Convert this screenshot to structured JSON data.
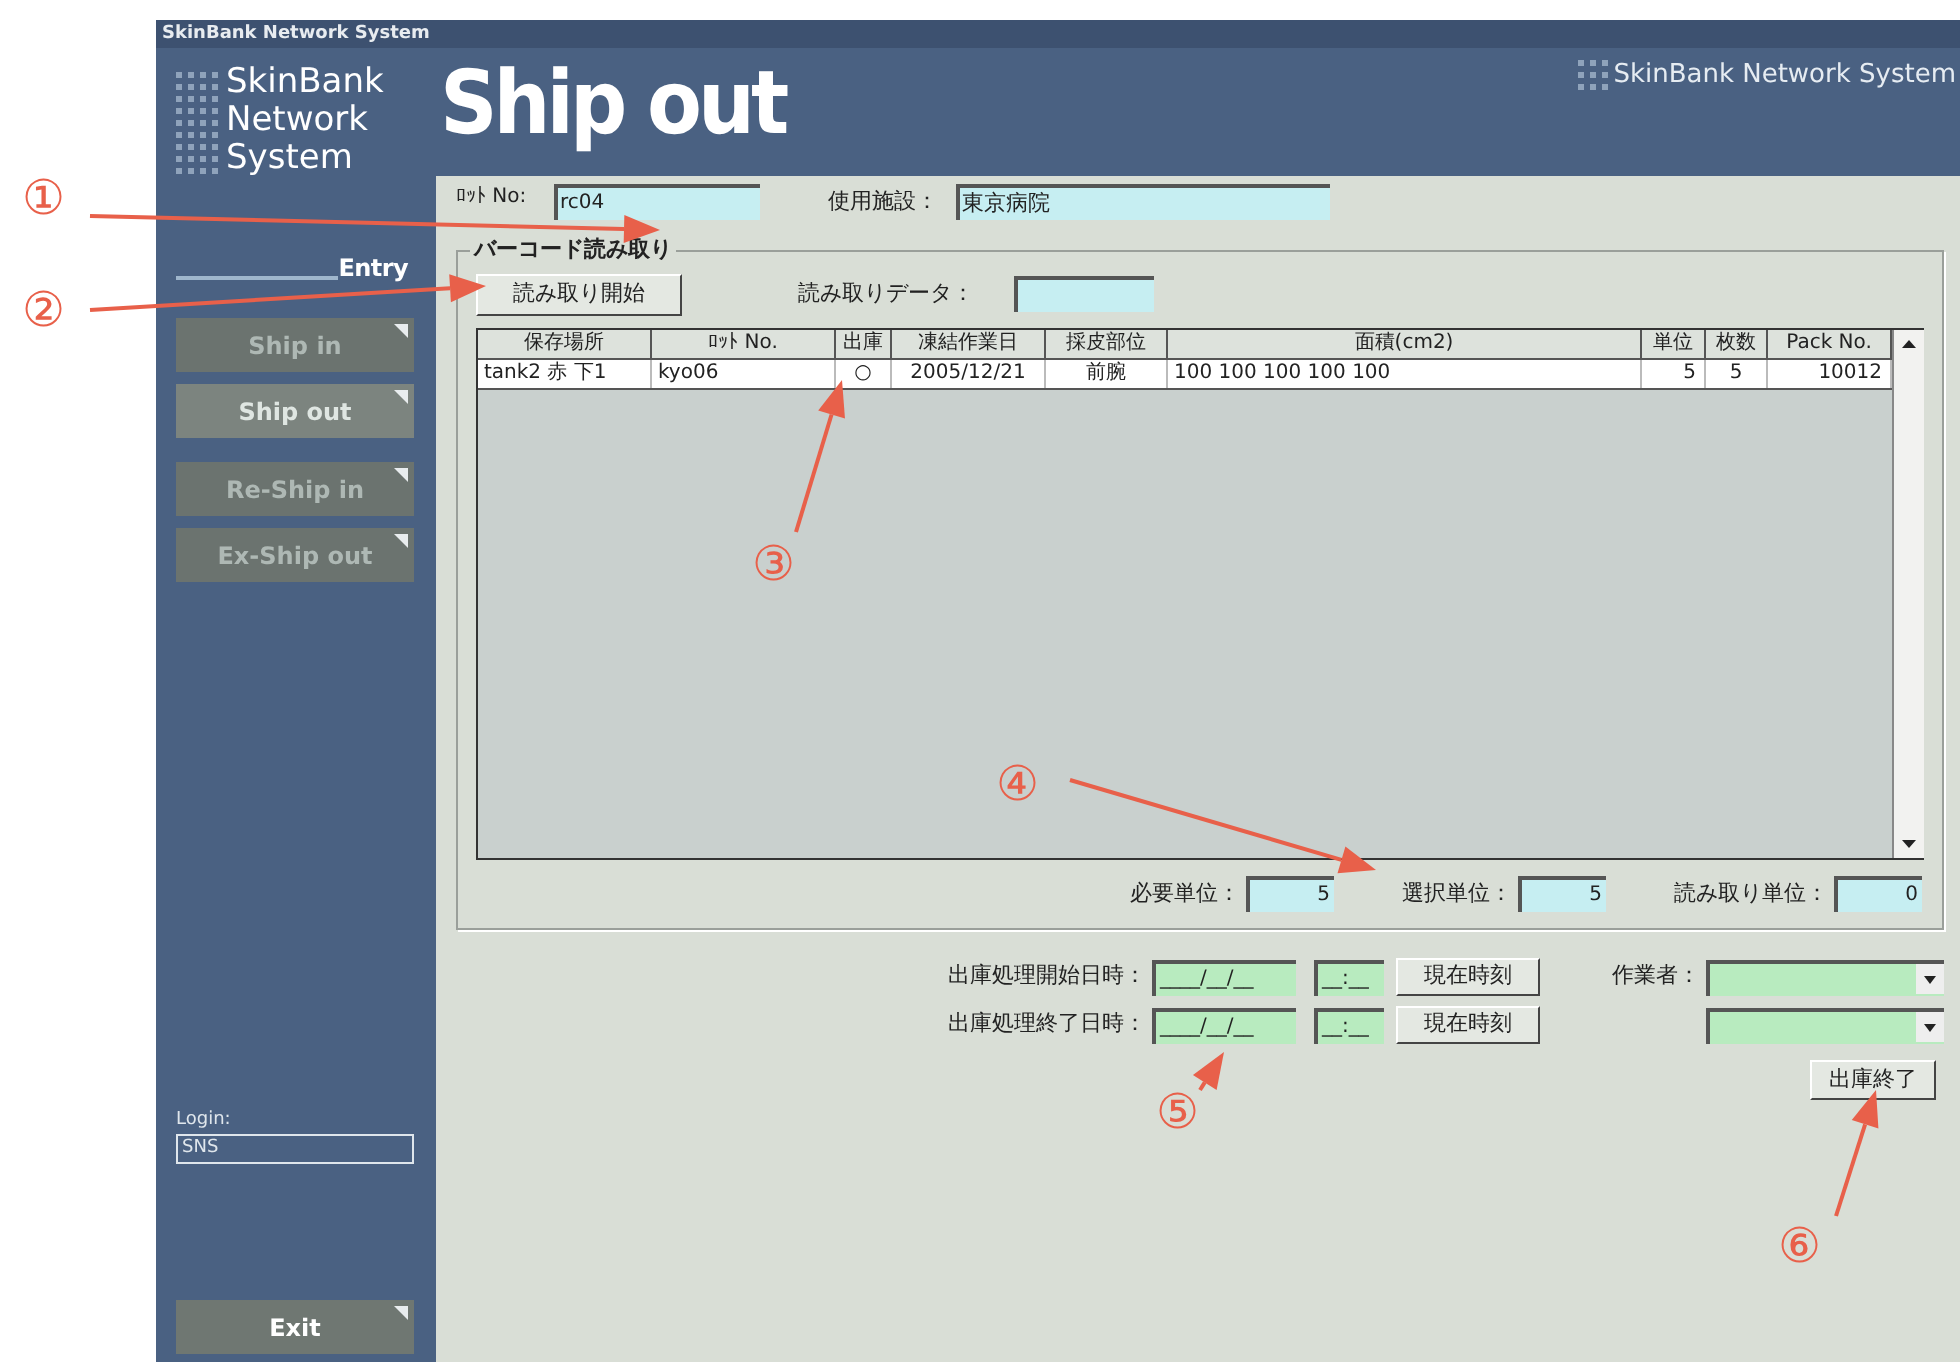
{
  "window": {
    "title": "SkinBank Network System"
  },
  "sidebar": {
    "logo_lines": [
      "SkinBank",
      "Network",
      "System"
    ],
    "section_label": "Entry",
    "nav": [
      {
        "label": "Ship in",
        "selected": false
      },
      {
        "label": "Ship out",
        "selected": true
      },
      {
        "label": "Re-Ship in",
        "selected": false
      },
      {
        "label": "Ex-Ship out",
        "selected": false
      }
    ],
    "login": {
      "label": "Login:",
      "value": "SNS"
    },
    "exit_button": "Exit"
  },
  "header": {
    "title": "Ship out",
    "brand": "SkinBank Network System"
  },
  "lot_no": {
    "label": "ﾛｯﾄ No:",
    "value": "rc04"
  },
  "facility": {
    "label": "使用施設：",
    "value": "東京病院"
  },
  "barcode_group": {
    "title": "バーコード読み取り",
    "start_button": "読み取り開始",
    "read_data_label": "読み取りデータ：",
    "table": {
      "columns": [
        "保存場所",
        "ﾛｯﾄ No.",
        "出庫",
        "凍結作業日",
        "採皮部位",
        "面積(cm2)",
        "単位",
        "枚数",
        "Pack No."
      ],
      "rows": [
        [
          "tank2 赤 下1",
          "kyo06",
          "○",
          "2005/12/21",
          "前腕",
          "100 100 100 100 100",
          "5",
          "5",
          "10012"
        ]
      ]
    },
    "totals": [
      {
        "label": "必要単位：",
        "value": "5"
      },
      {
        "label": "選択単位：",
        "value": "5"
      },
      {
        "label": "読み取り単位：",
        "value": "0"
      }
    ]
  },
  "process": {
    "rows": [
      {
        "label": "出庫処理開始日時：",
        "date": "____/__/__",
        "time": "__:__",
        "now_button": "現在時刻"
      },
      {
        "label": "出庫処理終了日時：",
        "date": "____/__/__",
        "time": "__:__",
        "now_button": "現在時刻"
      }
    ],
    "worker_label": "作業者：",
    "finish_button": "出庫終了"
  },
  "annotations": [
    {
      "number": "①"
    },
    {
      "number": "②"
    },
    {
      "number": "③"
    },
    {
      "number": "④"
    },
    {
      "number": "⑤"
    },
    {
      "number": "⑥"
    }
  ]
}
